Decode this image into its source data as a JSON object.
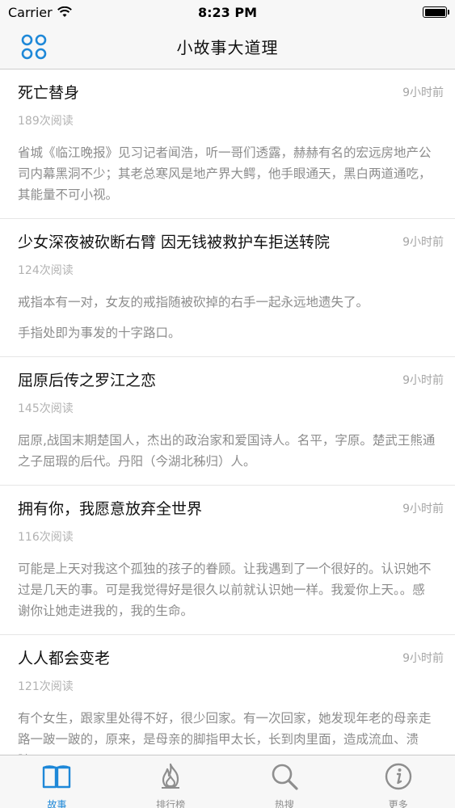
{
  "status_bar": {
    "carrier": "Carrier",
    "time": "8:23 PM",
    "battery_level": 1.0
  },
  "nav": {
    "title": "小故事大道理"
  },
  "stories": [
    {
      "title": "死亡替身",
      "time": "9小时前",
      "reads": "189次阅读",
      "body": [
        "省城《临江晚报》见习记者闻浩，听一哥们透露，赫赫有名的宏远房地产公司内幕黑洞不少；其老总寒风是地产界大鳄，他手眼通天，黑白两道通吃，其能量不可小视。"
      ]
    },
    {
      "title": "少女深夜被砍断右臂 因无钱被救护车拒送转院",
      "time": "9小时前",
      "reads": "124次阅读",
      "body": [
        "戒指本有一对，女友的戒指随被砍掉的右手一起永远地遗失了。",
        "手指处即为事发的十字路口。"
      ]
    },
    {
      "title": "屈原后传之罗江之恋",
      "time": "9小时前",
      "reads": "145次阅读",
      "body": [
        "屈原,战国末期楚国人，杰出的政治家和爱国诗人。名平，字原。楚武王熊通之子屈瑕的后代。丹阳（今湖北秭归）人。"
      ]
    },
    {
      "title": "拥有你，我愿意放弃全世界",
      "time": "9小时前",
      "reads": "116次阅读",
      "body": [
        "可能是上天对我这个孤独的孩子的眷顾。让我遇到了一个很好的。认识她不过是几天的事。可是我觉得好是很久以前就认识她一样。我爱你上天。。感谢你让她走进我的，我的生命。"
      ]
    },
    {
      "title": "人人都会变老",
      "time": "9小时前",
      "reads": "121次阅读",
      "body": [
        "有个女生，跟家里处得不好，很少回家。有一次回家，她发现年老的母亲走路一跛一跛的，原来，是母亲的脚指甲太长，长到肉里面，造成流血、溃脓。"
      ]
    }
  ],
  "tabs": [
    {
      "label": "故事",
      "icon": "book-icon",
      "active": true
    },
    {
      "label": "排行榜",
      "icon": "flame-icon",
      "active": false
    },
    {
      "label": "热搜",
      "icon": "search-icon",
      "active": false
    },
    {
      "label": "更多",
      "icon": "info-icon",
      "active": false
    }
  ],
  "colors": {
    "accent": "#1e88d8",
    "inactive": "#8e8e8e",
    "title": "#111111",
    "muted": "#8c8c8c"
  }
}
